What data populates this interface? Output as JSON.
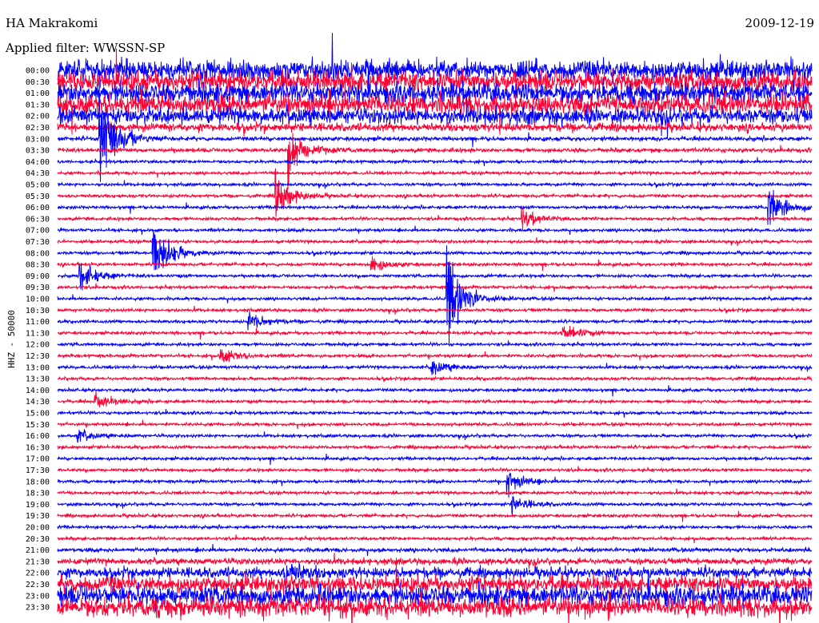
{
  "chart_data": {
    "type": "line",
    "title": "HA Makrakomi",
    "subtitle": "Applied filter: WWSSN-SP",
    "date": "2009-12-19",
    "ylabel": "HHZ - 50000",
    "xlabel": "",
    "x_range_minutes": [
      0,
      30
    ],
    "grid": false,
    "colors": {
      "even": "#0000ff",
      "odd": "#ff0033"
    },
    "row_labels": [
      "00:00",
      "00:30",
      "01:00",
      "01:30",
      "02:00",
      "02:30",
      "03:00",
      "03:30",
      "04:00",
      "04:30",
      "05:00",
      "05:30",
      "06:00",
      "06:30",
      "07:00",
      "07:30",
      "08:00",
      "08:30",
      "09:00",
      "09:30",
      "10:00",
      "10:30",
      "11:00",
      "11:30",
      "12:00",
      "12:30",
      "13:00",
      "13:30",
      "14:00",
      "14:30",
      "15:00",
      "15:30",
      "16:00",
      "16:30",
      "17:00",
      "17:30",
      "18:00",
      "18:30",
      "19:00",
      "19:30",
      "20:00",
      "20:30",
      "21:00",
      "21:30",
      "22:00",
      "22:30",
      "23:00",
      "23:30"
    ],
    "noise_level": [
      10,
      10,
      10,
      10,
      8,
      4,
      2,
      2,
      1.5,
      1.5,
      1.5,
      1.5,
      1.5,
      1.5,
      1.5,
      1.5,
      1.5,
      1.5,
      1.5,
      1.5,
      1.5,
      1.5,
      1.5,
      1.5,
      1.5,
      1.5,
      1.5,
      1.5,
      1.5,
      1.5,
      1.5,
      1.5,
      1.5,
      1.5,
      1.5,
      1.5,
      1.5,
      1.5,
      1.5,
      1.5,
      1.5,
      1.5,
      2,
      3,
      5,
      8,
      10,
      10
    ],
    "events": [
      {
        "row": 6,
        "minute": 1.7,
        "amplitude": 60
      },
      {
        "row": 7,
        "minute": 9.2,
        "amplitude": 30
      },
      {
        "row": 11,
        "minute": 8.7,
        "amplitude": 25
      },
      {
        "row": 12,
        "minute": 28.3,
        "amplitude": 25
      },
      {
        "row": 13,
        "minute": 18.5,
        "amplitude": 12
      },
      {
        "row": 16,
        "minute": 3.8,
        "amplitude": 40
      },
      {
        "row": 18,
        "minute": 0.9,
        "amplitude": 20
      },
      {
        "row": 17,
        "minute": 12.5,
        "amplitude": 10
      },
      {
        "row": 20,
        "minute": 15.5,
        "amplitude": 60
      },
      {
        "row": 22,
        "minute": 7.6,
        "amplitude": 12
      },
      {
        "row": 23,
        "minute": 20.1,
        "amplitude": 12
      },
      {
        "row": 25,
        "minute": 6.5,
        "amplitude": 10
      },
      {
        "row": 26,
        "minute": 14.9,
        "amplitude": 10
      },
      {
        "row": 29,
        "minute": 1.5,
        "amplitude": 10
      },
      {
        "row": 32,
        "minute": 0.8,
        "amplitude": 8
      },
      {
        "row": 36,
        "minute": 17.9,
        "amplitude": 14
      },
      {
        "row": 38,
        "minute": 18.1,
        "amplitude": 10
      },
      {
        "row": 44,
        "minute": 9.0,
        "amplitude": 14
      }
    ]
  }
}
